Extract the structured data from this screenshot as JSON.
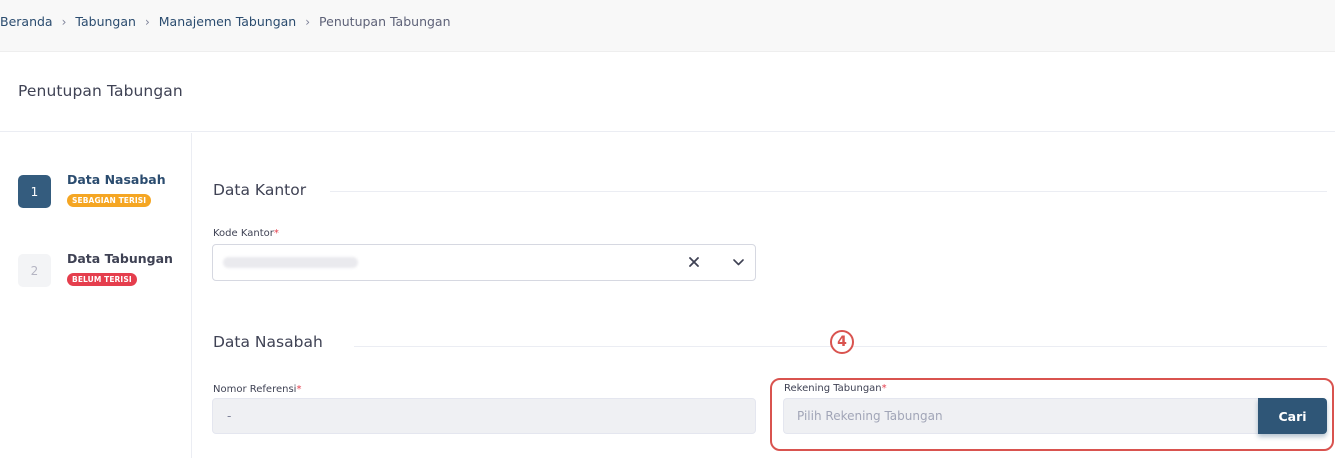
{
  "breadcrumb": {
    "items": [
      "Beranda",
      "Tabungan",
      "Manajemen Tabungan"
    ],
    "current": "Penutupan Tabungan",
    "separator": "›"
  },
  "page": {
    "title": "Penutupan Tabungan"
  },
  "stepper": {
    "steps": [
      {
        "number": "1",
        "label": "Data Nasabah",
        "badge": "SEBAGIAN TERISI",
        "state": "active",
        "badge_color": "#f5a623"
      },
      {
        "number": "2",
        "label": "Data Tabungan",
        "badge": "BELUM TERISI",
        "state": "inactive",
        "badge_color": "#e53e4d"
      }
    ]
  },
  "sections": {
    "kantor": {
      "title": "Data Kantor",
      "kode_kantor_label": "Kode Kantor",
      "required_mark": "*"
    },
    "nasabah": {
      "title": "Data Nasabah",
      "nomor_referensi_label": "Nomor Referensi",
      "nomor_referensi_value": "-",
      "rekening_label": "Rekening Tabungan",
      "rekening_placeholder": "Pilih Rekening Tabungan",
      "search_button": "Cari",
      "required_mark": "*"
    }
  },
  "annotation": {
    "marker": "4"
  },
  "colors": {
    "primary": "#2f5677",
    "required": "#e53e4d",
    "highlight": "#d9534f"
  }
}
